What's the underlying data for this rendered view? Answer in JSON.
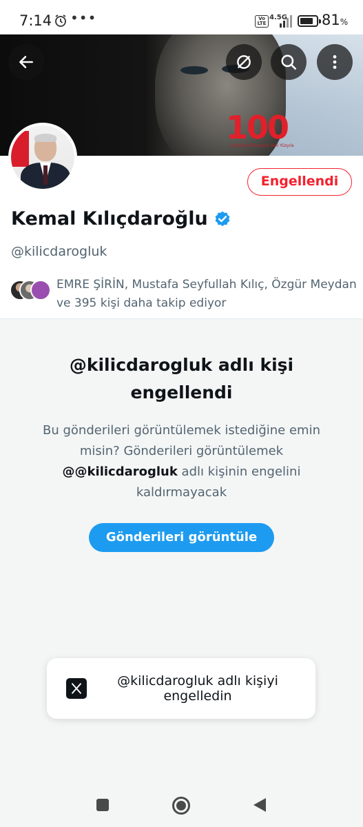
{
  "status_bar": {
    "time": "7:14",
    "overflow": "•••",
    "volte": "Vo LTE",
    "network": "4.5G",
    "battery_percent": "81",
    "battery_unit": "%",
    "battery_level": 0.81,
    "icons": [
      "alarm-icon",
      "signal-icon",
      "battery-icon"
    ]
  },
  "header": {
    "back_icon": "arrow-left-icon",
    "explore_icon": "compass-slash-icon",
    "search_icon": "search-icon",
    "more_icon": "more-vertical-icon",
    "banner_number": "100",
    "banner_tagline": "Geçmişin Mirasıyla Yeni Yüzyıla"
  },
  "profile": {
    "blocked_label": "Engellendi",
    "name": "Kemal Kılıçdaroğlu",
    "handle": "@kilicdarogluk",
    "followers_text": "EMRE ŞİRİN, Mustafa Seyfullah Kılıç, Özgür Meydan ve 395 kişi daha takip ediyor"
  },
  "blocked_panel": {
    "title": "@kilicdarogluk adlı kişi engellendi",
    "desc_prefix": "Bu gönderileri görüntülemek istediğine emin misin? Gönderileri görüntülemek ",
    "desc_handle": "@@kilicdarogluk",
    "desc_suffix": " adlı kişinin engelini kaldırmayacak",
    "view_button": "Gönderileri görüntüle"
  },
  "toast": {
    "logo": "x-logo-icon",
    "text": "@kilicdarogluk adlı kişiyi engelledin"
  },
  "colors": {
    "accent": "#1d9bf0",
    "danger": "#f4212e",
    "muted": "#536471"
  }
}
